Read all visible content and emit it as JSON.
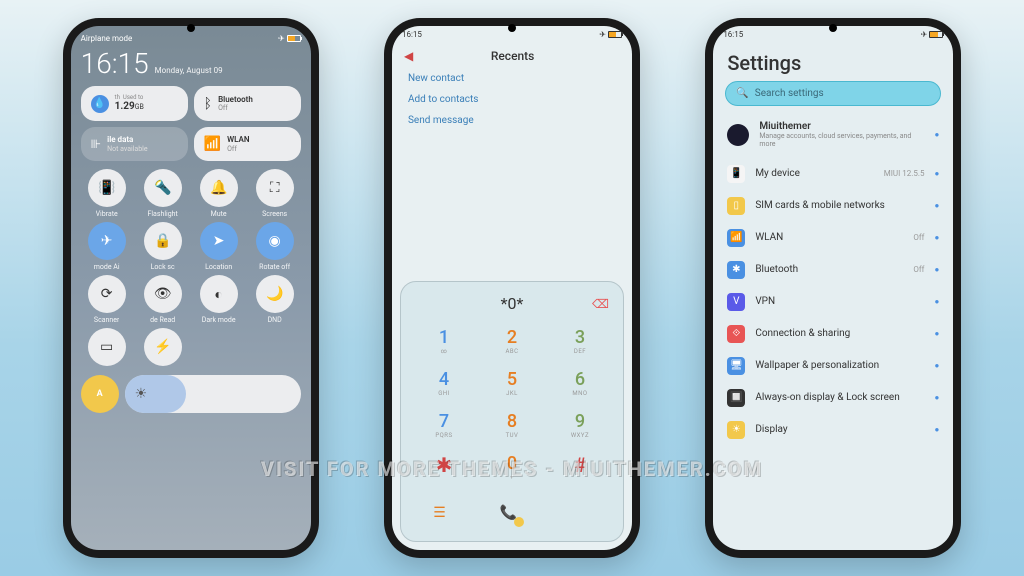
{
  "watermark": "Visit for more themes - Miuithemer.com",
  "phone1": {
    "status_left": "Airplane mode",
    "time": "16:15",
    "date": "Monday, August 09",
    "tiles": {
      "data": {
        "sub1": "th",
        "sub2": "Used to",
        "value": "1.29",
        "unit": "GB"
      },
      "bluetooth": {
        "label": "Bluetooth",
        "status": "Off"
      },
      "mobile": {
        "label": "ile data",
        "status": "Not available"
      },
      "wlan": {
        "label": "WLAN",
        "status": "Off"
      }
    },
    "circles": [
      {
        "icon": "📳",
        "label": "Vibrate",
        "on": false
      },
      {
        "icon": "🔦",
        "label": "Flashlight",
        "on": false
      },
      {
        "icon": "🔔",
        "label": "Mute",
        "on": false
      },
      {
        "icon": "⛶",
        "label": "Screens",
        "on": false
      },
      {
        "icon": "✈",
        "label": "mode   Ai",
        "on": true
      },
      {
        "icon": "🔒",
        "label": "Lock sc",
        "on": false
      },
      {
        "icon": "➤",
        "label": "Location",
        "on": true
      },
      {
        "icon": "◉",
        "label": "Rotate off",
        "on": true
      },
      {
        "icon": "⟳",
        "label": "Scanner",
        "on": false
      },
      {
        "icon": "👁",
        "label": "de   Read",
        "on": false
      },
      {
        "icon": "◐",
        "label": "Dark mode",
        "on": false
      },
      {
        "icon": "🌙",
        "label": "DND",
        "on": false
      },
      {
        "icon": "▭",
        "label": "",
        "on": false
      },
      {
        "icon": "⚡",
        "label": "",
        "on": false
      }
    ],
    "auto": "A"
  },
  "phone2": {
    "time": "16:15",
    "title": "Recents",
    "links": [
      "New contact",
      "Add to contacts",
      "Send message"
    ],
    "display_value": "*0*",
    "keys": [
      {
        "n": "1",
        "s": "∞"
      },
      {
        "n": "2",
        "s": "ABC"
      },
      {
        "n": "3",
        "s": "DEF"
      },
      {
        "n": "4",
        "s": "GHI"
      },
      {
        "n": "5",
        "s": "JKL"
      },
      {
        "n": "6",
        "s": "MNO"
      },
      {
        "n": "7",
        "s": "PQRS"
      },
      {
        "n": "8",
        "s": "TUV"
      },
      {
        "n": "9",
        "s": "WXYZ"
      },
      {
        "n": "✱",
        "s": ""
      },
      {
        "n": "0",
        "s": "+"
      },
      {
        "n": "#",
        "s": ""
      }
    ]
  },
  "phone3": {
    "time": "16:15",
    "title": "Settings",
    "search_placeholder": "Search settings",
    "account": {
      "name": "Miuithemer",
      "sub": "Manage accounts, cloud services, payments, and more"
    },
    "items": [
      {
        "icon": "📱",
        "label": "My device",
        "value": "MIUI 12.5.5",
        "color": "#f5f5f5"
      },
      {
        "icon": "▯",
        "label": "SIM cards & mobile networks",
        "value": "",
        "color": "#f2c84b"
      },
      {
        "icon": "📶",
        "label": "WLAN",
        "value": "Off",
        "color": "#4a90e2"
      },
      {
        "icon": "✱",
        "label": "Bluetooth",
        "value": "Off",
        "color": "#4a90e2"
      },
      {
        "icon": "V",
        "label": "VPN",
        "value": "",
        "color": "#5a5ae8"
      },
      {
        "icon": "⟐",
        "label": "Connection & sharing",
        "value": "",
        "color": "#e85555"
      },
      {
        "icon": "🖥",
        "label": "Wallpaper & personalization",
        "value": "",
        "color": "#4a90e2"
      },
      {
        "icon": "🔲",
        "label": "Always-on display & Lock screen",
        "value": "",
        "color": "#333"
      },
      {
        "icon": "☀",
        "label": "Display",
        "value": "",
        "color": "#f2c84b"
      }
    ]
  }
}
